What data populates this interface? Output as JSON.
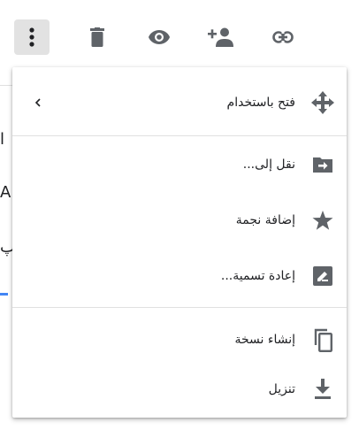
{
  "toolbar": {
    "buttons": [
      {
        "name": "more-options",
        "icon": "more-vert-icon"
      },
      {
        "name": "delete",
        "icon": "trash-icon"
      },
      {
        "name": "preview",
        "icon": "eye-icon"
      },
      {
        "name": "share",
        "icon": "add-person-icon"
      },
      {
        "name": "get-link",
        "icon": "link-icon"
      }
    ]
  },
  "background": {
    "chars": [
      "ا",
      "A",
      "پ"
    ]
  },
  "menu": {
    "items": [
      {
        "label": "فتح باستخدام",
        "icon": "move-arrows-icon",
        "submenu_arrow": "‹"
      },
      {
        "label": "نقل إلى...",
        "icon": "folder-move-icon"
      },
      {
        "label": "إضافة نجمة",
        "icon": "star-icon"
      },
      {
        "label": "إعادة تسمية...",
        "icon": "rename-pencil-icon"
      },
      {
        "label": "إنشاء نسخة",
        "icon": "copy-icon"
      },
      {
        "label": "تنزيل",
        "icon": "download-icon"
      }
    ]
  },
  "colors": {
    "icon": "#5f6368",
    "text": "#202124",
    "active_button_bg": "#e2e2e2",
    "divider": "#e0e0e0",
    "accent": "#4285f4"
  }
}
